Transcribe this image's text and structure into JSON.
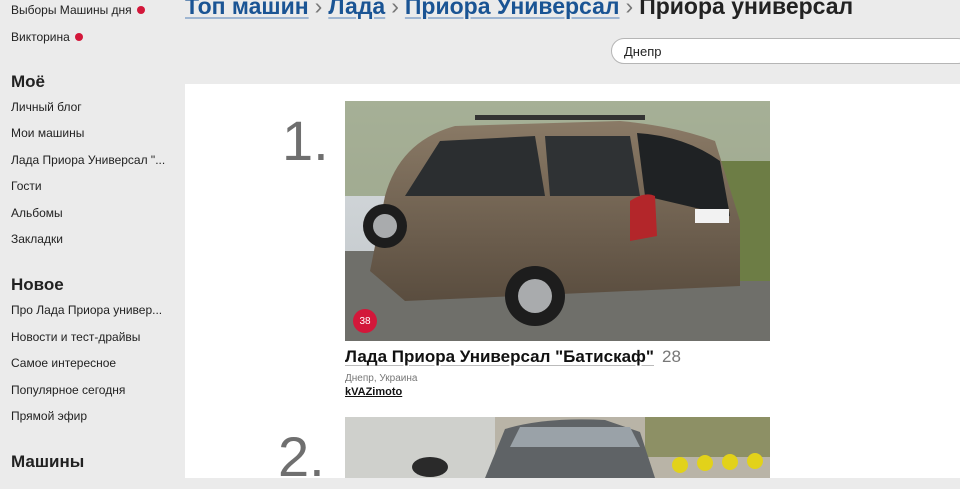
{
  "sidebar": {
    "top_links": [
      {
        "label": "Выборы Машины дня",
        "dot": true
      },
      {
        "label": "Викторина",
        "dot": true
      }
    ],
    "sections": [
      {
        "title": "Моё",
        "items": [
          "Личный блог",
          "Мои машины",
          "Лада Приора Универсал \"...",
          "Гости",
          "Альбомы",
          "Закладки"
        ]
      },
      {
        "title": "Новое",
        "items": [
          "Про Лада Приора универ...",
          "Новости и тест-драйвы",
          "Самое интересное",
          "Популярное сегодня",
          "Прямой эфир"
        ]
      },
      {
        "title": "Машины",
        "items": []
      }
    ]
  },
  "breadcrumb": {
    "items": [
      "Топ машин",
      "Лада",
      "Приора Универсал"
    ],
    "separator": "›",
    "current": "Приора универсал"
  },
  "search": {
    "value": "Днепр"
  },
  "cars": [
    {
      "rank": "1.",
      "photo_icon": "car-photo",
      "badge": "38",
      "title": "Лада Приора Универсал \"Батискаф\"",
      "count": "28",
      "location": "Днепр, Украина",
      "owner": "kVAZimoto"
    },
    {
      "rank": "2.",
      "photo_icon": "car-photo",
      "badge": "",
      "title": "",
      "count": "",
      "location": "",
      "owner": ""
    }
  ],
  "colors": {
    "accent": "#d3173a",
    "link": "#1a5494",
    "sidebar_bg": "#ebebeb"
  }
}
